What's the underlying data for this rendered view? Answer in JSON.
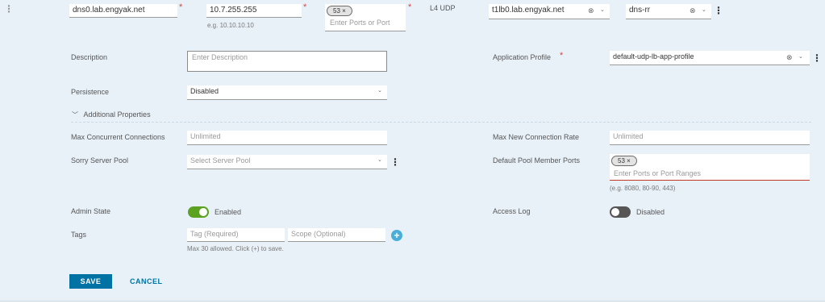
{
  "row": {
    "fqdn": "dns0.lab.engyak.net",
    "ip": "10.7.255.255",
    "ip_hint": "e.g. 10.10.10.10",
    "port_tag": "53",
    "ports_placeholder": "Enter Ports or Port",
    "protocol": "L4 UDP",
    "lb_service": "t1lb0.lab.engyak.net",
    "pool": "dns-rr"
  },
  "form": {
    "description_label": "Description",
    "description_placeholder": "Enter Description",
    "app_profile_label": "Application Profile",
    "app_profile_value": "default-udp-lb-app-profile",
    "persistence_label": "Persistence",
    "persistence_value": "Disabled",
    "additional_label": "Additional Properties",
    "max_conn_label": "Max Concurrent Connections",
    "max_conn_placeholder": "Unlimited",
    "max_rate_label": "Max New Connection Rate",
    "max_rate_placeholder": "Unlimited",
    "sorry_label": "Sorry Server Pool",
    "sorry_placeholder": "Select Server Pool",
    "default_ports_label": "Default Pool Member Ports",
    "default_port_tag": "53",
    "default_ports_placeholder": "Enter Ports or Port Ranges",
    "default_ports_hint": "(e.g. 8080, 80-90, 443)",
    "admin_label": "Admin State",
    "admin_value": "Enabled",
    "access_label": "Access Log",
    "access_value": "Disabled",
    "tags_label": "Tags",
    "tag_placeholder": "Tag (Required)",
    "scope_placeholder": "Scope (Optional)",
    "tags_hint": "Max 30 allowed. Click (+) to save."
  },
  "buttons": {
    "save": "SAVE",
    "cancel": "CANCEL"
  },
  "colors": {
    "accent": "#0072a3",
    "toggle_on": "#5aa220",
    "toggle_off": "#565656",
    "required": "#d64541"
  },
  "icons": [
    "row-kebab-icon",
    "close-tag-icon",
    "clear-icon",
    "chevron-down-icon",
    "kebab-icon",
    "chevron-down-expand-icon",
    "add-circle-icon"
  ]
}
